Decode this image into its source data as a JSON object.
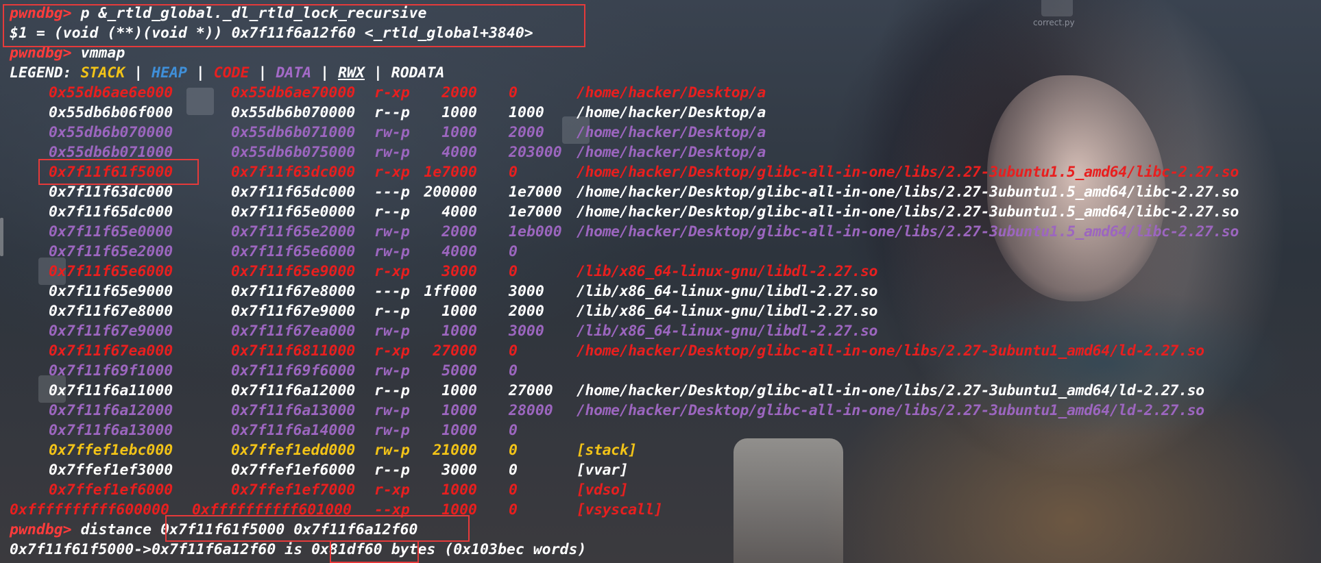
{
  "desktop": {
    "icon_labels": [
      "correct.py"
    ]
  },
  "colors": {
    "prompt": "#ff3b3b",
    "stack": "#f2c318",
    "heap": "#3f8fd8",
    "code": "#e81f1f",
    "data": "#9c66bf",
    "highlight_box": "#e63a3a"
  },
  "terminal": {
    "prompt": "pwndbg>",
    "cmd1": "p &_rtld_global._dl_rtld_lock_recursive",
    "result1": "$1 = (void (**)(void *)) 0x7f11f6a12f60 <_rtld_global+3840>",
    "cmd2": "vmmap",
    "legend": {
      "label": "LEGEND:",
      "stack": "STACK",
      "heap": "HEAP",
      "code": "CODE",
      "data": "DATA",
      "rwx": "RWX",
      "rodata": "RODATA",
      "sep": "|"
    },
    "mappings": [
      {
        "start": "0x55db6ae6e000",
        "end": "0x55db6ae70000",
        "perm": "r-xp",
        "size": "2000",
        "offset": "0",
        "path": "/home/hacker/Desktop/a",
        "kind": "code"
      },
      {
        "start": "0x55db6b06f000",
        "end": "0x55db6b070000",
        "perm": "r--p",
        "size": "1000",
        "offset": "1000",
        "path": "/home/hacker/Desktop/a",
        "kind": "ro"
      },
      {
        "start": "0x55db6b070000",
        "end": "0x55db6b071000",
        "perm": "rw-p",
        "size": "1000",
        "offset": "2000",
        "path": "/home/hacker/Desktop/a",
        "kind": "data"
      },
      {
        "start": "0x55db6b071000",
        "end": "0x55db6b075000",
        "perm": "rw-p",
        "size": "4000",
        "offset": "203000",
        "path": "/home/hacker/Desktop/a",
        "kind": "data"
      },
      {
        "start": "0x7f11f61f5000",
        "end": "0x7f11f63dc000",
        "perm": "r-xp",
        "size": "1e7000",
        "offset": "0",
        "path": "/home/hacker/Desktop/glibc-all-in-one/libs/2.27-3ubuntu1.5_amd64/libc-2.27.so",
        "kind": "code"
      },
      {
        "start": "0x7f11f63dc000",
        "end": "0x7f11f65dc000",
        "perm": "---p",
        "size": "200000",
        "offset": "1e7000",
        "path": "/home/hacker/Desktop/glibc-all-in-one/libs/2.27-3ubuntu1.5_amd64/libc-2.27.so",
        "kind": "ro"
      },
      {
        "start": "0x7f11f65dc000",
        "end": "0x7f11f65e0000",
        "perm": "r--p",
        "size": "4000",
        "offset": "1e7000",
        "path": "/home/hacker/Desktop/glibc-all-in-one/libs/2.27-3ubuntu1.5_amd64/libc-2.27.so",
        "kind": "ro"
      },
      {
        "start": "0x7f11f65e0000",
        "end": "0x7f11f65e2000",
        "perm": "rw-p",
        "size": "2000",
        "offset": "1eb000",
        "path": "/home/hacker/Desktop/glibc-all-in-one/libs/2.27-3ubuntu1.5_amd64/libc-2.27.so",
        "kind": "data"
      },
      {
        "start": "0x7f11f65e2000",
        "end": "0x7f11f65e6000",
        "perm": "rw-p",
        "size": "4000",
        "offset": "0",
        "path": "",
        "kind": "data"
      },
      {
        "start": "0x7f11f65e6000",
        "end": "0x7f11f65e9000",
        "perm": "r-xp",
        "size": "3000",
        "offset": "0",
        "path": "/lib/x86_64-linux-gnu/libdl-2.27.so",
        "kind": "code"
      },
      {
        "start": "0x7f11f65e9000",
        "end": "0x7f11f67e8000",
        "perm": "---p",
        "size": "1ff000",
        "offset": "3000",
        "path": "/lib/x86_64-linux-gnu/libdl-2.27.so",
        "kind": "ro"
      },
      {
        "start": "0x7f11f67e8000",
        "end": "0x7f11f67e9000",
        "perm": "r--p",
        "size": "1000",
        "offset": "2000",
        "path": "/lib/x86_64-linux-gnu/libdl-2.27.so",
        "kind": "ro"
      },
      {
        "start": "0x7f11f67e9000",
        "end": "0x7f11f67ea000",
        "perm": "rw-p",
        "size": "1000",
        "offset": "3000",
        "path": "/lib/x86_64-linux-gnu/libdl-2.27.so",
        "kind": "data"
      },
      {
        "start": "0x7f11f67ea000",
        "end": "0x7f11f6811000",
        "perm": "r-xp",
        "size": "27000",
        "offset": "0",
        "path": "/home/hacker/Desktop/glibc-all-in-one/libs/2.27-3ubuntu1_amd64/ld-2.27.so",
        "kind": "code"
      },
      {
        "start": "0x7f11f69f1000",
        "end": "0x7f11f69f6000",
        "perm": "rw-p",
        "size": "5000",
        "offset": "0",
        "path": "",
        "kind": "data"
      },
      {
        "start": "0x7f11f6a11000",
        "end": "0x7f11f6a12000",
        "perm": "r--p",
        "size": "1000",
        "offset": "27000",
        "path": "/home/hacker/Desktop/glibc-all-in-one/libs/2.27-3ubuntu1_amd64/ld-2.27.so",
        "kind": "ro"
      },
      {
        "start": "0x7f11f6a12000",
        "end": "0x7f11f6a13000",
        "perm": "rw-p",
        "size": "1000",
        "offset": "28000",
        "path": "/home/hacker/Desktop/glibc-all-in-one/libs/2.27-3ubuntu1_amd64/ld-2.27.so",
        "kind": "data"
      },
      {
        "start": "0x7f11f6a13000",
        "end": "0x7f11f6a14000",
        "perm": "rw-p",
        "size": "1000",
        "offset": "0",
        "path": "",
        "kind": "data"
      },
      {
        "start": "0x7ffef1ebc000",
        "end": "0x7ffef1edd000",
        "perm": "rw-p",
        "size": "21000",
        "offset": "0",
        "path": "[stack]",
        "kind": "stack"
      },
      {
        "start": "0x7ffef1ef3000",
        "end": "0x7ffef1ef6000",
        "perm": "r--p",
        "size": "3000",
        "offset": "0",
        "path": "[vvar]",
        "kind": "ro"
      },
      {
        "start": "0x7ffef1ef6000",
        "end": "0x7ffef1ef7000",
        "perm": "r-xp",
        "size": "1000",
        "offset": "0",
        "path": "[vdso]",
        "kind": "code"
      },
      {
        "start": "0xffffffffff600000",
        "end": "0xffffffffff601000",
        "perm": "--xp",
        "size": "1000",
        "offset": "0",
        "path": "[vsyscall]",
        "kind": "code"
      }
    ],
    "cmd3_name": "distance",
    "cmd3_args": "0x7f11f61f5000 0x7f11f6a12f60",
    "result3_pre": "0x7f11f61f5000->0x7f11f6a12f60 is ",
    "result3_value": "0x81df60",
    "result3_post": " bytes (0x103bec words)"
  }
}
